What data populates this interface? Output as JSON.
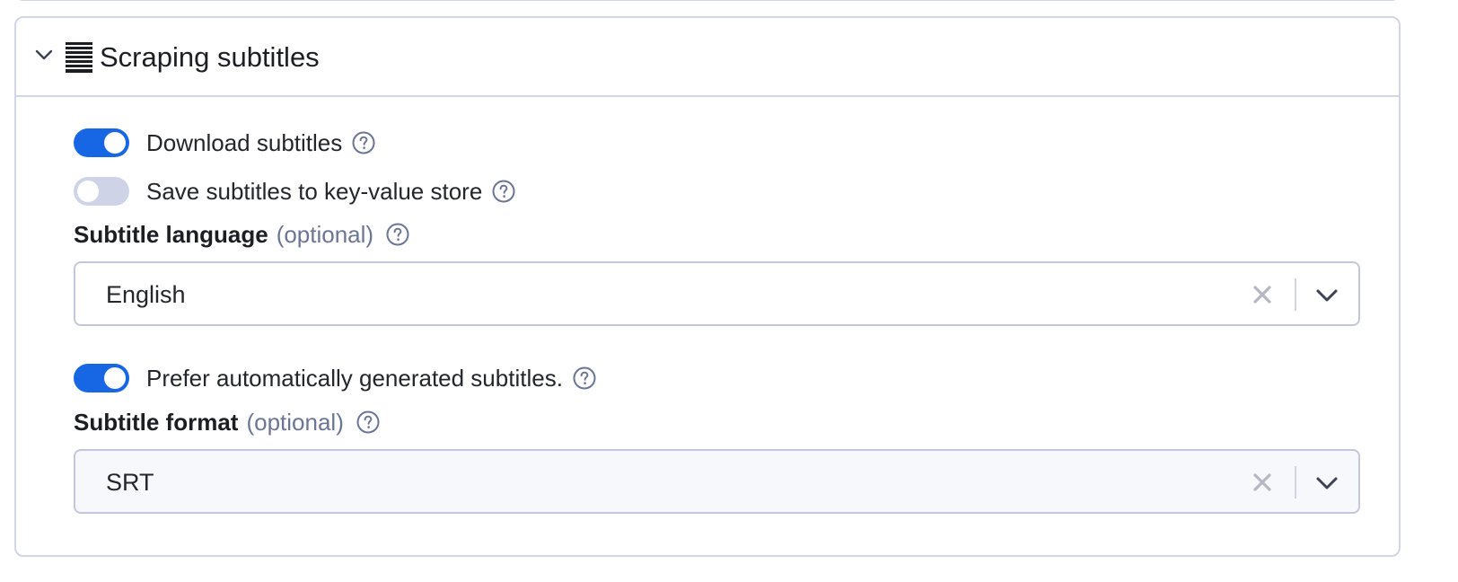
{
  "section": {
    "title": "Scraping subtitles",
    "icon": "subtitles-lines-icon",
    "collapse_icon": "chevron-down-icon"
  },
  "download_subtitles": {
    "label": "Download subtitles",
    "enabled": true
  },
  "save_to_kv_store": {
    "label": "Save subtitles to key-value store",
    "enabled": false
  },
  "subtitle_language": {
    "label": "Subtitle language",
    "optional_text": "(optional)",
    "value": "English"
  },
  "prefer_auto_generated": {
    "label": "Prefer automatically generated subtitles.",
    "enabled": true
  },
  "subtitle_format": {
    "label": "Subtitle format",
    "optional_text": "(optional)",
    "value": "SRT"
  },
  "colors": {
    "toggle_on": "#1767e4",
    "toggle_off": "#cfd3e7",
    "border": "#d1d5e6",
    "muted_text": "#6b7594"
  }
}
